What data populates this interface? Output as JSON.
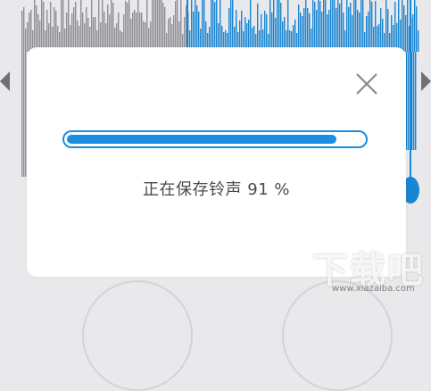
{
  "dialog": {
    "title": "",
    "status_text": "正在保存铃声",
    "progress_percent": 91,
    "percent_text": "91 %",
    "close_icon": "close-icon"
  },
  "background": {
    "waveform_colors": {
      "unplayed": "#8e8e94",
      "played": "#1a86d2"
    },
    "left_arrow_icon": "chevron-left-icon",
    "right_arrow_icon": "chevron-right-icon"
  },
  "watermark": {
    "text": "下载吧",
    "subtext": "www.xiazaiba.com"
  },
  "colors": {
    "accent": "#1a8ee0",
    "dialog_bg": "#ffffff",
    "backdrop": "#e9e9ec"
  }
}
